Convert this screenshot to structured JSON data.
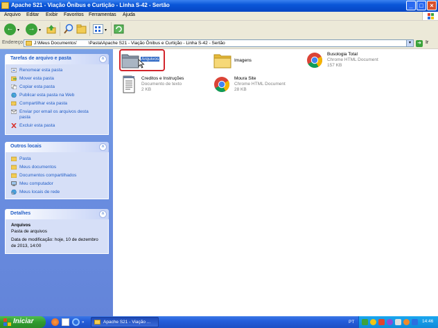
{
  "window": {
    "title": "Apache S21 - Viação Ônibus e Curtição - Linha S-42 - Sertão",
    "controls": [
      "_",
      "□",
      "×"
    ]
  },
  "menu": [
    "Arquivo",
    "Editar",
    "Exibir",
    "Favoritos",
    "Ferramentas",
    "Ajuda"
  ],
  "address": {
    "label": "Endereço",
    "path": "J:\\Meus Documentos'         \\Pasta\\Apache S21 - Viação Ônibus e Curtição - Linha S-42 - Sertão",
    "go_label": "Ir"
  },
  "tasks_box": {
    "title": "Tarefas de arquivo e pasta",
    "items": [
      {
        "label": "Renomear esta pasta",
        "icon": "rename-icon"
      },
      {
        "label": "Mover esta pasta",
        "icon": "move-icon"
      },
      {
        "label": "Copiar esta pasta",
        "icon": "copy-icon"
      },
      {
        "label": "Publicar esta pasta na Web",
        "icon": "globe-icon"
      },
      {
        "label": "Compartilhar esta pasta",
        "icon": "share-icon"
      },
      {
        "label": "Enviar por email os arquivos desta",
        "label2": "pasta",
        "icon": "email-icon"
      },
      {
        "label": "Excluir esta pasta",
        "icon": "delete-icon"
      }
    ]
  },
  "places_box": {
    "title": "Outros locais",
    "items": [
      {
        "label": "Pasta",
        "icon": "folder-icon"
      },
      {
        "label": "Meus documentos",
        "icon": "folder-icon"
      },
      {
        "label": "Documentos compartilhados",
        "icon": "folder-icon"
      },
      {
        "label": "Meu computador",
        "icon": "computer-icon"
      },
      {
        "label": "Meus locais de rede",
        "icon": "network-icon"
      }
    ]
  },
  "details_box": {
    "title": "Detalhes",
    "name": "Arquivos",
    "type": "Pasta de arquivos",
    "modified": "Data de modificação: hoje, 10 de dezembro",
    "modified2": "de 2013, 14:00"
  },
  "files": [
    {
      "name": "Arquivos",
      "icon": "folder-icon"
    },
    {
      "name": "Imagens",
      "icon": "folder-icon"
    },
    {
      "name": "Busologia Total",
      "type": "Chrome HTML Document",
      "size": "157 KB",
      "icon": "chrome-icon"
    },
    {
      "name": "Creditos e Instruções",
      "type": "Documento de texto",
      "size": "2 KB",
      "icon": "text-document-icon"
    },
    {
      "name": "Moura Site",
      "type": "Chrome HTML Document",
      "size": "28 KB",
      "icon": "chrome-icon"
    }
  ],
  "taskbar": {
    "start_label": "Iniciar",
    "window_button": "Apache S21 - Viação ...",
    "lang": "PT",
    "clock": "14:46"
  }
}
